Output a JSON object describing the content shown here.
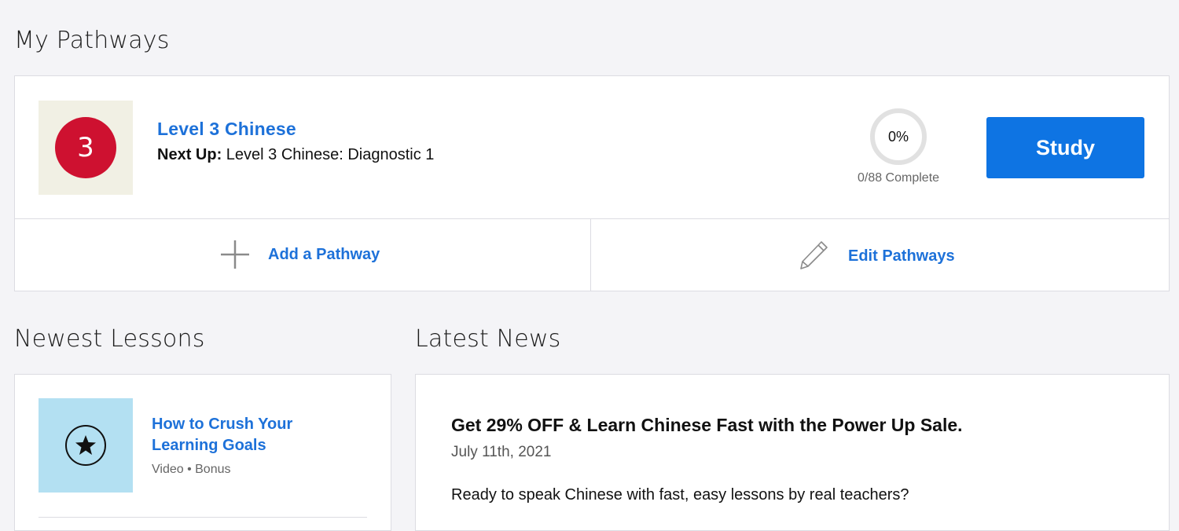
{
  "pathways": {
    "title": "My Pathways",
    "item": {
      "level_number": "3",
      "name": "Level 3 Chinese",
      "next_up_label": "Next Up:",
      "next_up_value": "Level 3 Chinese: Diagnostic 1",
      "progress_percent": "0%",
      "progress_fraction": 0,
      "progress_count": "0/88 Complete",
      "study_label": "Study",
      "thumb_color": "#f1f0e4",
      "level_color": "#ce1130"
    },
    "actions": {
      "add_label": "Add a Pathway",
      "add_icon": "plus-icon",
      "edit_label": "Edit Pathways",
      "edit_icon": "pencil-icon"
    }
  },
  "lessons": {
    "title": "Newest Lessons",
    "items": [
      {
        "title": "How to Crush Your Learning Goals",
        "meta": "Video • Bonus",
        "icon": "star-icon",
        "thumb_color": "#b3e0f2"
      }
    ]
  },
  "news": {
    "title": "Latest News",
    "items": [
      {
        "headline": "Get 29% OFF & Learn Chinese Fast with the Power Up Sale.",
        "date": "July 11th, 2021",
        "body": "Ready to speak Chinese with fast, easy lessons by real teachers?"
      }
    ]
  },
  "colors": {
    "accent": "#1d71d9",
    "button": "#0e74e3",
    "background": "#f4f4f7"
  }
}
